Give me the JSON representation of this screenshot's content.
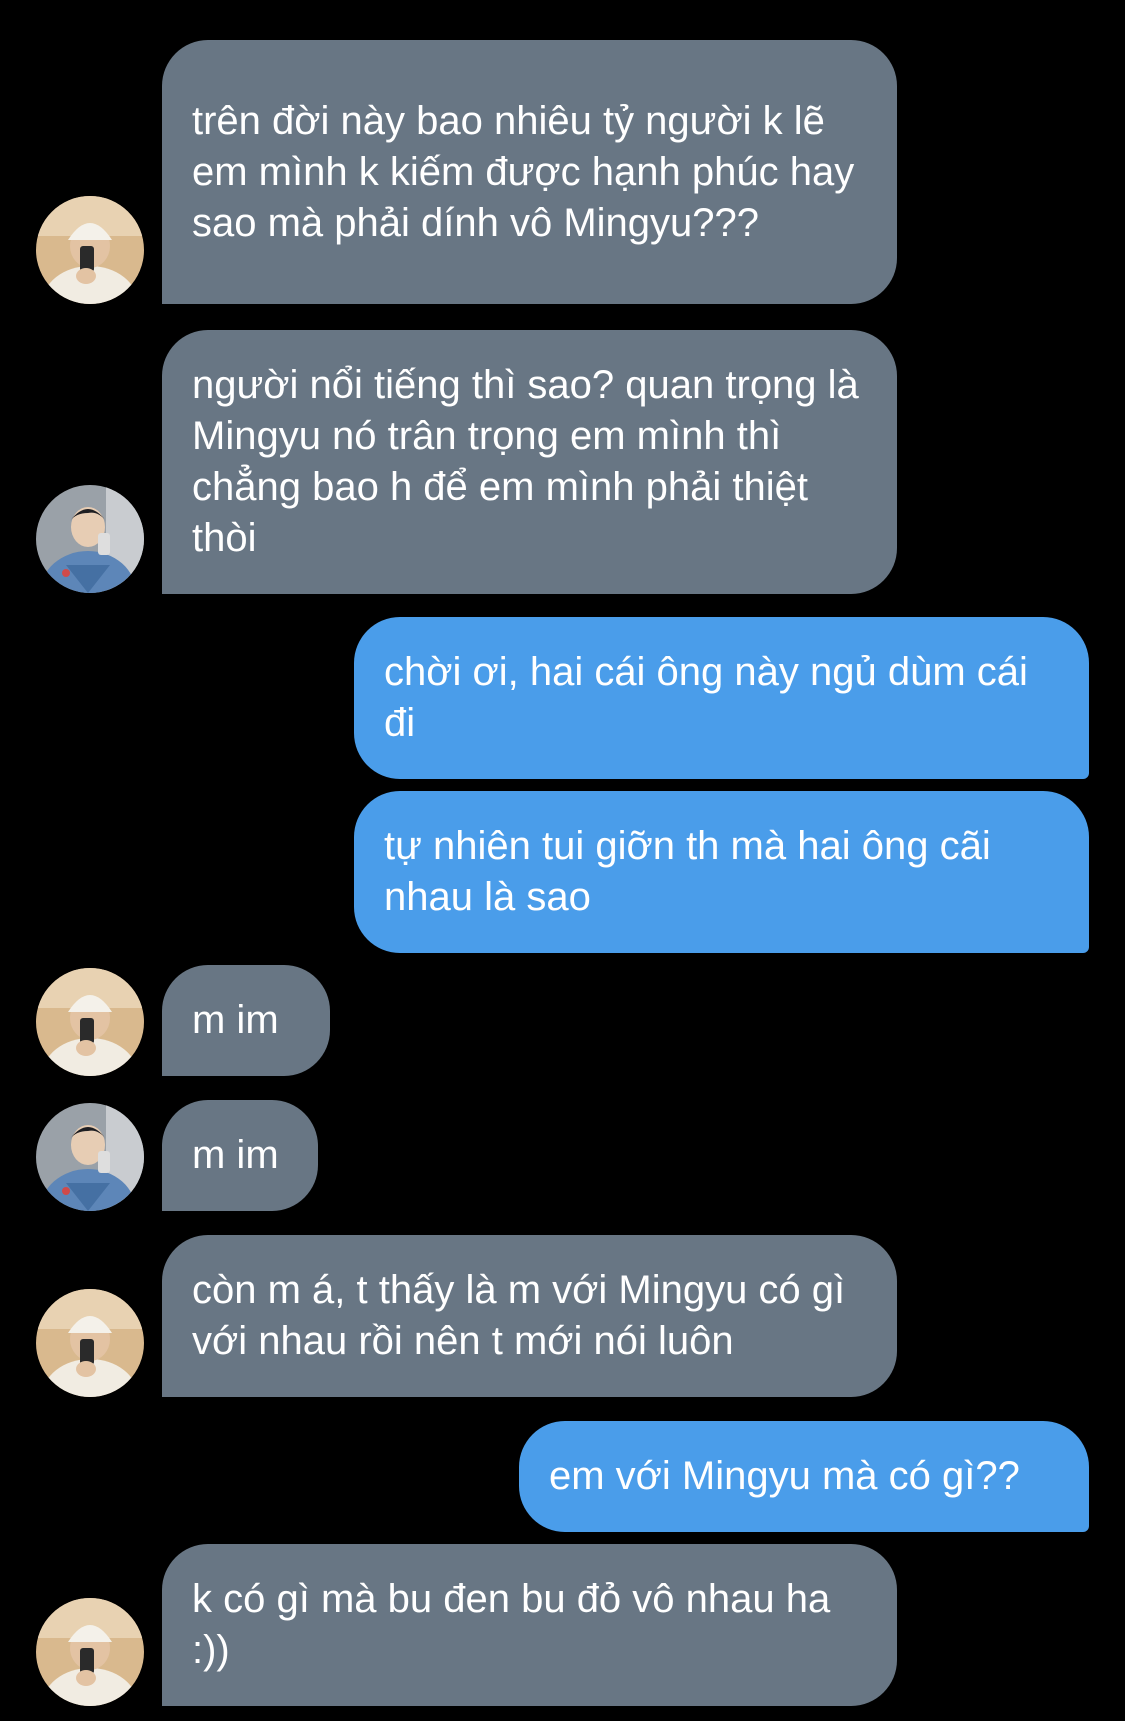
{
  "colors": {
    "background": "#000000",
    "incoming_bubble": "#687684",
    "outgoing_bubble": "#4a9dea",
    "text": "#ffffff"
  },
  "avatars": {
    "a": "avatar-person-white-beanie-icon",
    "b": "avatar-person-denim-jacket-icon"
  },
  "messages": [
    {
      "side": "in",
      "avatar": "a",
      "text": "trên đời này bao nhiêu tỷ người k lẽ em mình k kiếm được hạnh phúc hay sao mà phải dính vô Mingyu???"
    },
    {
      "side": "in",
      "avatar": "b",
      "text": "người nổi tiếng thì sao? quan trọng là Mingyu nó trân trọng em mình thì chẳng bao h để em mình phải thiệt thòi"
    },
    {
      "side": "out",
      "text": "chời ơi, hai cái ông này ngủ dùm cái đi"
    },
    {
      "side": "out",
      "text": "tự nhiên tui giỡn th mà hai ông cãi nhau là sao"
    },
    {
      "side": "in",
      "avatar": "a",
      "text": "m im"
    },
    {
      "side": "in",
      "avatar": "b",
      "text": "m im"
    },
    {
      "side": "in",
      "avatar": "a",
      "text": "còn m á, t thấy là m với Mingyu có gì với nhau rồi nên t mới nói luôn"
    },
    {
      "side": "out",
      "text": "em với Mingyu mà có gì??"
    },
    {
      "side": "in",
      "avatar": "a",
      "text": "k có gì mà bu đen bu đỏ vô nhau ha :))"
    }
  ]
}
